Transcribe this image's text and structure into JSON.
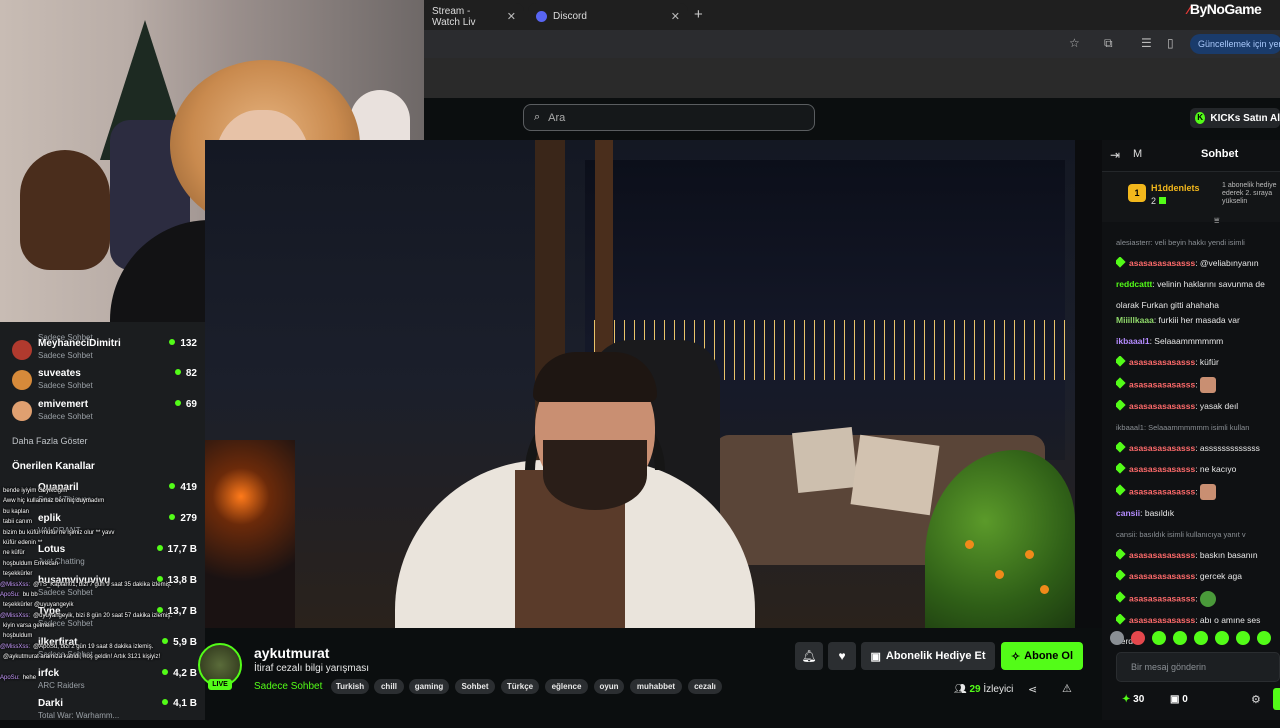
{
  "browser": {
    "tabs": [
      {
        "title": "Stream - Watch Liv"
      },
      {
        "title": "Discord"
      }
    ],
    "new_tab_glyph": "+",
    "close_glyph": "✕",
    "brand": "ByNoGame",
    "update_label": "Güncellemek için yenic"
  },
  "header": {
    "search_placeholder": "Ara",
    "kicks_label": "KICKs Satın Al"
  },
  "sidebar": {
    "channels": [
      {
        "name": "",
        "category": "Sadece Sohbet",
        "viewers": ""
      },
      {
        "name": "MeyhaneciDimitri",
        "category": "Sadece Sohbet",
        "viewers": "132",
        "color": "#c0392b"
      },
      {
        "name": "suveates",
        "category": "Sadece Sohbet",
        "viewers": "82",
        "color": "#d68a3a"
      },
      {
        "name": "emivemert",
        "category": "Sadece Sohbet",
        "viewers": "69",
        "color": "#e0a070"
      }
    ],
    "show_more": "Daha Fazla Göster",
    "recommended_title": "Önerilen Kanallar",
    "recommended": [
      {
        "name": "Quanaril",
        "category": "Sea of Thieves",
        "viewers": "419"
      },
      {
        "name": "eplik",
        "category": "VALORANT",
        "viewers": "279"
      },
      {
        "name": "Lotus",
        "category": "Just Chatting",
        "viewers": "17,7 B"
      },
      {
        "name": "husamvivuvivu",
        "category": "Sadece Sohbet",
        "viewers": "13,8 B"
      },
      {
        "name": "Type",
        "category": "Sadece Sohbet",
        "viewers": "13,7 B"
      },
      {
        "name": "ilkerfirat",
        "category": "Sadece Sohbet",
        "viewers": "5,9 B"
      },
      {
        "name": "irfck",
        "category": "ARC Raiders",
        "viewers": "4,2 B"
      },
      {
        "name": "Darki",
        "category": "Total War: Warhamm...",
        "viewers": "4,1 B"
      }
    ]
  },
  "overlay_chat": [
    {
      "user": "",
      "text": "bende iyiyim Geyikciğim"
    },
    {
      "user": "",
      "text": "Aww hiç kullanmaz ben hiç duymadım"
    },
    {
      "user": "",
      "text": "bu kaplan"
    },
    {
      "user": "",
      "text": "tabii canım"
    },
    {
      "user": "",
      "text": "bizim bu küfür müfür ne işimiz olur ** yavv"
    },
    {
      "user": "",
      "text": "küfür edenin **"
    },
    {
      "user": "",
      "text": "ne küfür"
    },
    {
      "user": "",
      "text": "hoşbuldum Emrecan"
    },
    {
      "user": "",
      "text": "teşekkürler"
    },
    {
      "user": "@MissXss:",
      "text": "@TS_Kaplan01, bizi 7 gün 9 saat 35 dakika izlemiş."
    },
    {
      "user": "ApoSu:",
      "text": "bu bb"
    },
    {
      "user": "",
      "text": "teşekkürler @uyuyangeyik"
    },
    {
      "user": "@MissXss:",
      "text": "@uyuyangeyik, bizi 8 gün 20 saat 57 dakika izlemiş."
    },
    {
      "user": "",
      "text": "kiyin varsa gelmem"
    },
    {
      "user": "",
      "text": "hoşbuldum"
    },
    {
      "user": "@MissXss:",
      "text": "@ApoSu, bizi 2 gün 19 saat 8 dakika izlemiş."
    },
    {
      "user": "",
      "text": "@aykutmurat aramıza katıldı, hoş geldin! Artık 3121 kişiyiz!"
    },
    {
      "user": "",
      "text": ""
    },
    {
      "user": "ApoSu:",
      "text": "hehe"
    }
  ],
  "stream": {
    "channel": "aykutmurat",
    "title": "İtiraf cezalı bilgi yarışması",
    "category": "Sadece Sohbet",
    "live_label": "LIVE",
    "tags": [
      "Turkish",
      "chill",
      "gaming",
      "Sohbet",
      "Türkçe",
      "eğlence",
      "oyun",
      "muhabbet",
      "cezalı"
    ],
    "gift_label": "Abonelik Hediye Et",
    "subscribe_label": "Abone Ol",
    "viewers_count": "29",
    "viewers_label": "İzleyici"
  },
  "chat": {
    "mode_label": "M",
    "title": "Sohbet",
    "pinned": {
      "user": "H1ddenlets",
      "count": "2",
      "text": "1 abonelik hediye ederek 2. sıraya yükselin"
    },
    "messages": [
      {
        "kind": "reply",
        "text": "alesiasterr: veli beyin hakkı yendi isimli"
      },
      {
        "kind": "msg",
        "icon": true,
        "user": "asasasasasasss",
        "ucolor": "#ff6b6b",
        "text": "@veliabınyanın"
      },
      {
        "kind": "msg",
        "icon": false,
        "user": "reddcattt",
        "ucolor": "#53fc18",
        "text": "velinin haklarını savunma de"
      },
      {
        "kind": "cont",
        "text": "olarak Furkan gitti ahahaha"
      },
      {
        "kind": "msg",
        "icon": false,
        "user": "Miiillkaaa",
        "ucolor": "#8fd86a",
        "text": "furkiii her masada var"
      },
      {
        "kind": "msg",
        "icon": false,
        "user": "ikbaaal1",
        "ucolor": "#b58cff",
        "text": "Selaaammmmmm"
      },
      {
        "kind": "msg",
        "icon": true,
        "user": "asasasasasasss",
        "ucolor": "#ff6b6b",
        "text": "küfür"
      },
      {
        "kind": "emote",
        "icon": true,
        "user": "asasasasasasss",
        "ucolor": "#ff6b6b",
        "text": ""
      },
      {
        "kind": "msg",
        "icon": true,
        "user": "asasasasasasss",
        "ucolor": "#ff6b6b",
        "text": "yasak deıl"
      },
      {
        "kind": "reply",
        "text": "ikbaaal1: Selaaammmmmm isimli kullan"
      },
      {
        "kind": "msg",
        "icon": true,
        "user": "asasasasasasss",
        "ucolor": "#ff6b6b",
        "text": "asssssssssssss"
      },
      {
        "kind": "msg",
        "icon": true,
        "user": "asasasasasasss",
        "ucolor": "#ff6b6b",
        "text": "ne kacıyo"
      },
      {
        "kind": "emote",
        "icon": true,
        "user": "asasasasasasss",
        "ucolor": "#ff6b6b",
        "text": ""
      },
      {
        "kind": "msg",
        "icon": false,
        "user": "cansii",
        "ucolor": "#b58cff",
        "text": "basıldık"
      },
      {
        "kind": "reply",
        "text": "cansii: basıldık isimli kullanıcıya yanıt v"
      },
      {
        "kind": "msg",
        "icon": true,
        "user": "asasasasasasss",
        "ucolor": "#ff6b6b",
        "text": "baskın basanın"
      },
      {
        "kind": "msg",
        "icon": true,
        "user": "asasasasasasss",
        "ucolor": "#ff6b6b",
        "text": "gercek aga"
      },
      {
        "kind": "frog",
        "icon": true,
        "user": "asasasasasasss",
        "ucolor": "#ff6b6b",
        "text": ""
      },
      {
        "kind": "msg",
        "icon": true,
        "user": "asasasasasasss",
        "ucolor": "#ff6b6b",
        "text": "abı o amıne ses"
      },
      {
        "kind": "cont",
        "text": "nerde"
      }
    ],
    "input_placeholder": "Bir mesaj gönderin",
    "points": "30",
    "gifts": "0"
  },
  "colors": {
    "accent": "#53fc18",
    "background": "#0b0e0f"
  }
}
